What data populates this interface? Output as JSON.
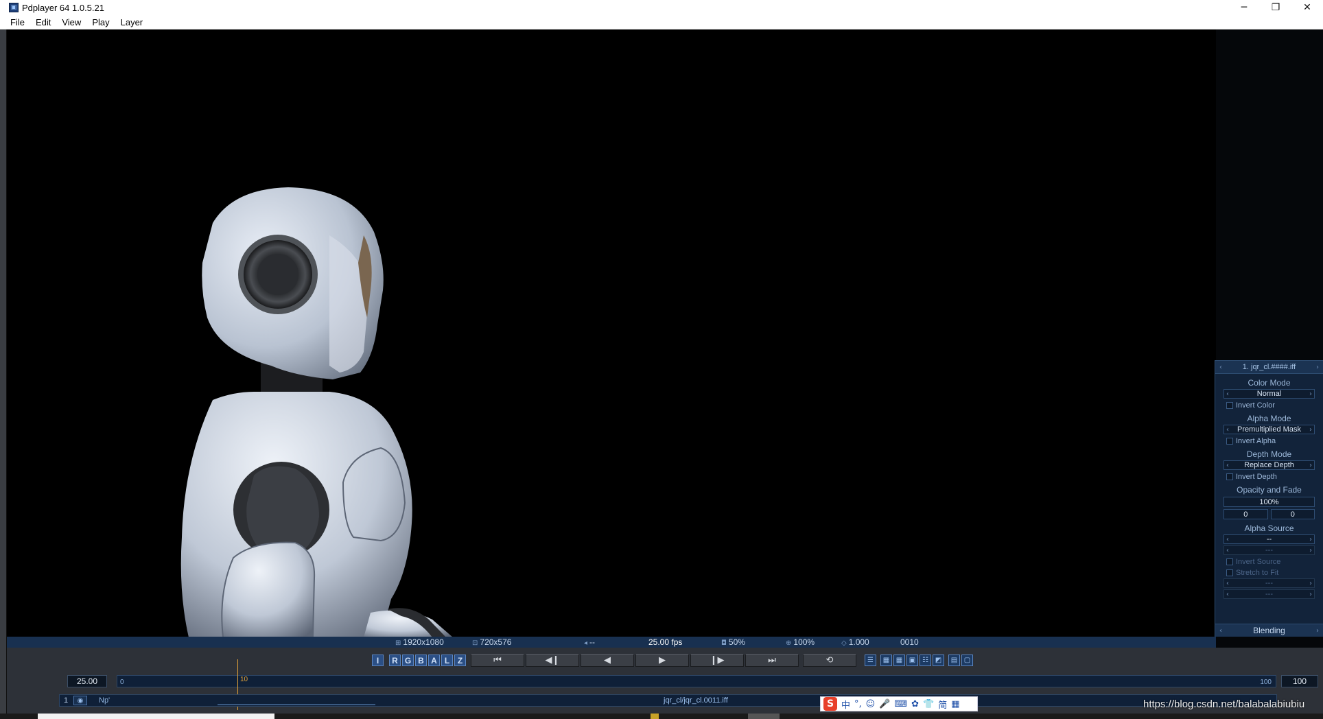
{
  "window": {
    "title": "Pdplayer 64 1.0.5.21",
    "minimize": "─",
    "restore": "❐",
    "close": "✕"
  },
  "menu": [
    "File",
    "Edit",
    "View",
    "Play",
    "Layer"
  ],
  "infobar": {
    "resolution": "1920x1080",
    "display_size": "720x576",
    "audio": "--",
    "fps": "25.00 fps",
    "scale": "50%",
    "zoom": "100%",
    "gamma": "1.000",
    "frame": "0010"
  },
  "layer_panel": {
    "layer_name": "1. jqr_cl.####.iff",
    "color_mode_label": "Color Mode",
    "color_mode": "Normal",
    "invert_color": "Invert Color",
    "alpha_mode_label": "Alpha Mode",
    "alpha_mode": "Premultiplied Mask",
    "invert_alpha": "Invert Alpha",
    "depth_mode_label": "Depth Mode",
    "depth_mode": "Replace Depth",
    "invert_depth": "Invert Depth",
    "opacity_label": "Opacity and Fade",
    "opacity": "100%",
    "fade_in": "0",
    "fade_out": "0",
    "alpha_source_label": "Alpha Source",
    "alpha_source": "--",
    "alpha_source_sub": "---",
    "invert_source": "Invert Source",
    "stretch_to_fit": "Stretch to Fit",
    "extra_1": "---",
    "extra_2": "---",
    "blending": "Blending"
  },
  "channels": [
    "I",
    "R",
    "G",
    "B",
    "A",
    "L",
    "Z"
  ],
  "transport": {
    "first": "⏮",
    "prev_frame": "◀❙",
    "play_back": "◀",
    "play": "▶",
    "next_frame": "❙▶",
    "last": "⏭",
    "loop": "⟲"
  },
  "layout_buttons": [
    "☰",
    "▦",
    "▦",
    "▣",
    "☷",
    "◩",
    "▤",
    "▢"
  ],
  "timeline": {
    "fps_value": "25.00",
    "start": "0",
    "end": "100",
    "end_value": "100",
    "current": "10"
  },
  "track": {
    "index": "1",
    "eye": "◉",
    "label": "Np'",
    "filename": "jqr_cl/jqr_cl.0011.iff"
  },
  "ime": {
    "logo": "S",
    "icons": [
      "中",
      "°,",
      "☺",
      "🎤",
      "⌨",
      "✿",
      "👕",
      "简",
      "▦"
    ]
  },
  "watermark": "https://blog.csdn.net/balabalabiubiu"
}
